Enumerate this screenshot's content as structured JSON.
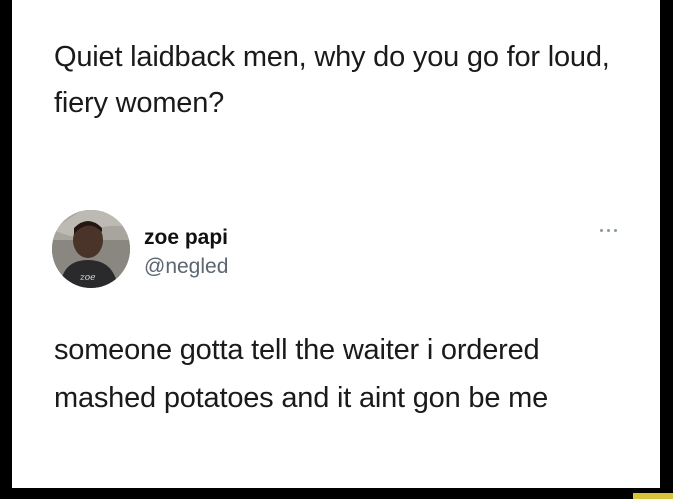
{
  "question": {
    "text": "Quiet laidback men, why do you go for loud, fiery women?"
  },
  "tweet": {
    "author_name": "zoe papi",
    "author_handle": "@negled",
    "more_icon": "ellipsis-icon",
    "avatar_hoodie_text": "zoe",
    "body": "someone gotta tell the waiter i ordered mashed potatoes and it aint gon be me"
  },
  "colors": {
    "background": "#000000",
    "card": "#ffffff",
    "text": "#1a1a1a",
    "handle": "#5b6670",
    "more_dots": "#8899a6"
  }
}
